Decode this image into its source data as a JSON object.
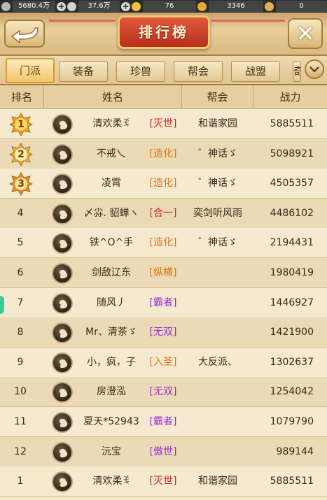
{
  "currencies": [
    {
      "icon": "silver-coin-icon",
      "value": "5680.4万",
      "has_plus": true,
      "color": "#b8b8b8"
    },
    {
      "icon": "silver-ingot-icon",
      "value": "37.6万",
      "has_plus": true,
      "color": "#d0d4d8"
    },
    {
      "icon": "gold-ingot-icon",
      "value": "76",
      "has_plus": false,
      "color": "#f0c040"
    },
    {
      "icon": "gold-bag-icon",
      "value": "3346",
      "has_plus": false,
      "color": "#e8a830"
    },
    {
      "icon": "token-coin-icon",
      "value": "0",
      "has_plus": false,
      "color": "#e0b050"
    }
  ],
  "header": {
    "title": "排行榜",
    "close_label": "✕"
  },
  "tabs": [
    {
      "label": "门派",
      "active": true
    },
    {
      "label": "装备",
      "active": false
    },
    {
      "label": "珍兽",
      "active": false
    },
    {
      "label": "帮会",
      "active": false
    },
    {
      "label": "战盟",
      "active": false
    },
    {
      "label": "奇",
      "active": false
    }
  ],
  "columns": {
    "rank": "排名",
    "name": "姓名",
    "guild": "帮会",
    "power": "战力"
  },
  "rows": [
    {
      "rank": "1",
      "name": "清欢柔ꉂ",
      "sect": "[灭世]",
      "sect_color": "red",
      "guild": "和谐家园",
      "power": "5885511",
      "badge": "gold"
    },
    {
      "rank": "2",
      "name": "不戒乀",
      "sect": "[造化]",
      "sect_color": "orange",
      "guild": "゛神话ゞ",
      "power": "5098921",
      "badge": "silver"
    },
    {
      "rank": "3",
      "name": "凌霄",
      "sect": "[造化]",
      "sect_color": "orange",
      "guild": "゛神话ゞ",
      "power": "4505357",
      "badge": "bronze"
    },
    {
      "rank": "4",
      "name": "〆尛. 貂蝉ヽ",
      "sect": "[合一]",
      "sect_color": "red",
      "guild": "奕剑听风雨",
      "power": "4486102",
      "badge": ""
    },
    {
      "rank": "5",
      "name": "铁^O^手",
      "sect": "[造化]",
      "sect_color": "orange",
      "guild": "゛神话ゞ",
      "power": "2194431",
      "badge": ""
    },
    {
      "rank": "6",
      "name": "剑敌辽东",
      "sect": "[纵横]",
      "sect_color": "orange",
      "guild": "",
      "power": "1980419",
      "badge": ""
    },
    {
      "rank": "7",
      "name": "随风丿",
      "sect": "[霸者]",
      "sect_color": "purple",
      "guild": "",
      "power": "1446927",
      "badge": ""
    },
    {
      "rank": "8",
      "name": "Mr、清茶ゞ",
      "sect": "[无双]",
      "sect_color": "purple",
      "guild": "",
      "power": "1421900",
      "badge": ""
    },
    {
      "rank": "9",
      "name": "小，疯，子",
      "sect": "[入圣]",
      "sect_color": "orange",
      "guild": "大反派、",
      "power": "1302637",
      "badge": ""
    },
    {
      "rank": "10",
      "name": "房澄泓",
      "sect": "[无双]",
      "sect_color": "purple",
      "guild": "",
      "power": "1254042",
      "badge": ""
    },
    {
      "rank": "11",
      "name": "夏天*52943",
      "sect": "[霸者]",
      "sect_color": "purple",
      "guild": "",
      "power": "1079790",
      "badge": ""
    },
    {
      "rank": "12",
      "name": "沅宝",
      "sect": "[傲世]",
      "sect_color": "purple",
      "guild": "",
      "power": "989144",
      "badge": ""
    },
    {
      "rank": "1",
      "name": "清欢柔ꉂ",
      "sect": "[灭世]",
      "sect_color": "red",
      "guild": "和谐家园",
      "power": "5885511",
      "badge": ""
    }
  ]
}
